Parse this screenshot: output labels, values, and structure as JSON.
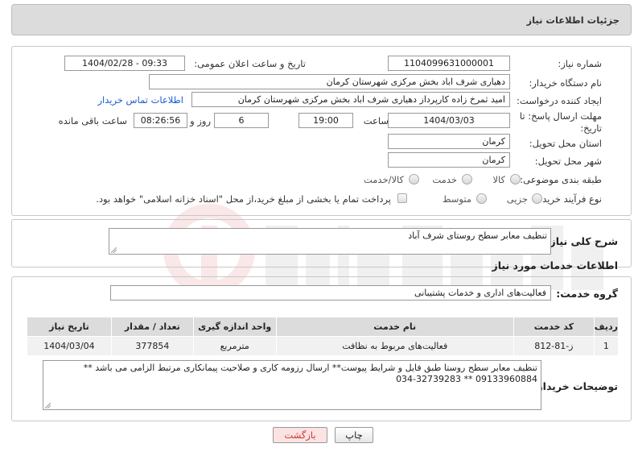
{
  "header": {
    "title": "جزئیات اطلاعات نیاز"
  },
  "fields": {
    "need_number_label": "شماره نیاز:",
    "need_number": "1104099631000001",
    "announce_label": "تاریخ و ساعت اعلان عمومی:",
    "announce_value": "1404/02/28 - 09:33",
    "buyer_org_label": "نام دستگاه خریدار:",
    "buyer_org": "دهیاری شرف اباد بخش مرکزی شهرستان کرمان",
    "creator_label": "ایجاد کننده درخواست:",
    "creator": "امید ثمرخ زاده کارپرداز دهیاری شرف اباد بخش مرکزی شهرستان کرمان",
    "contact_link": "اطلاعات تماس خریدار",
    "deadline_label_1": "مهلت ارسال پاسخ: تا",
    "deadline_label_2": "تاریخ:",
    "deadline_date": "1404/03/03",
    "time_label": "ساعت",
    "deadline_time": "19:00",
    "days_value": "6",
    "days_label": "روز و",
    "remaining_time": "08:26:56",
    "remaining_label": "ساعت باقی مانده",
    "province_label": "استان محل تحویل:",
    "province": "کرمان",
    "city_label": "شهر محل تحویل:",
    "city": "کرمان",
    "category_label": "طبقه بندی موضوعی:",
    "category_options": [
      "کالا",
      "خدمت",
      "کالا/خدمت"
    ],
    "process_label": "نوع فرآیند خرید :",
    "process_options": [
      "جزیی",
      "متوسط"
    ],
    "payment_note": "پرداخت تمام یا بخشی از مبلغ خرید،از محل \"اسناد خزانه اسلامی\" خواهد بود."
  },
  "summary": {
    "label": "شرح کلی نیاز:",
    "value": "تنظیف معابر سطح روستای شرف آباد"
  },
  "services": {
    "section_title": "اطلاعات خدمات مورد نیاز",
    "group_label": "گروه خدمت:",
    "group_value": "فعالیت‌های اداری و خدمات پشتیبانی",
    "columns": [
      "ردیف",
      "کد خدمت",
      "نام خدمت",
      "واحد اندازه گیری",
      "تعداد / مقدار",
      "تاریخ نیاز"
    ],
    "rows": [
      [
        "1",
        "ز-81-812",
        "فعالیت‌های مربوط به نظافت",
        "مترمربع",
        "377854",
        "1404/03/04"
      ]
    ]
  },
  "buyer_notes": {
    "label": "توضیحات خریدار:",
    "line1": "تنظیف معابر سطح روستا طبق فایل و شرایط پیوست** ارسال رزومه کاری و صلاحیت پیمانکاری مرتبط الزامی می باشد **",
    "line2": "09133960884 ** 034-32739283"
  },
  "buttons": {
    "print": "چاپ",
    "back": "بازگشت"
  },
  "colors": {
    "header_bg": "#dcdcdc",
    "link": "#1a5ccf",
    "back_button_bg": "#fbe3e3",
    "back_button_text": "#c33"
  }
}
